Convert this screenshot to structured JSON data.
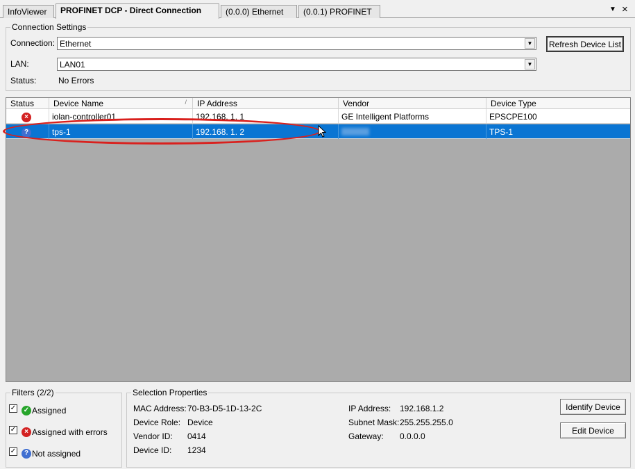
{
  "tabs": [
    {
      "label": "InfoViewer"
    },
    {
      "label": "PROFINET   DCP - Direct Connection"
    },
    {
      "label": "(0.0.0) Ethernet"
    },
    {
      "label": "(0.0.1) PROFINET"
    }
  ],
  "tab_controls": {
    "dropdown": "▼",
    "close": "×"
  },
  "connection_settings": {
    "title": "Connection Settings",
    "connection_label": "Connection:",
    "connection_value": "Ethernet",
    "lan_label": "LAN:",
    "lan_value": "LAN01",
    "status_label": "Status:",
    "status_value": "No Errors",
    "refresh_button": "Refresh Device List"
  },
  "grid": {
    "columns": [
      "Status",
      "Device Name",
      "IP Address",
      "Vendor",
      "Device Type"
    ],
    "sort_indicator": "/",
    "rows": [
      {
        "status_icon": "error-icon",
        "device_name": "iolan-controller01",
        "ip": "192.168.  1.  1",
        "vendor": "GE Intelligent Platforms",
        "type": "EPSCPE100"
      },
      {
        "status_icon": "question-icon",
        "device_name": "tps-1",
        "ip": "192.168.  1.  2",
        "vendor": "",
        "type": "TPS-1"
      }
    ]
  },
  "filters": {
    "title": "Filters  (2/2)",
    "items": [
      {
        "label": "Assigned",
        "checked": "✓"
      },
      {
        "label": "Assigned with errors",
        "checked": "✓"
      },
      {
        "label": "Not assigned",
        "checked": "✓"
      }
    ]
  },
  "selection": {
    "title": "Selection Properties",
    "mac_label": "MAC Address:",
    "mac_value": "70-B3-D5-1D-13-2C",
    "role_label": "Device Role:",
    "role_value": "Device",
    "vendor_id_label": "Vendor ID:",
    "vendor_id_value": "0414",
    "device_id_label": "Device ID:",
    "device_id_value": "1234",
    "ip_label": "IP Address:",
    "ip_value": "192.168.1.2",
    "subnet_label": "Subnet Mask:",
    "subnet_value": "255.255.255.0",
    "gateway_label": "Gateway:",
    "gateway_value": "0.0.0.0",
    "identify_button": "Identify Device",
    "edit_button": "Edit Device"
  },
  "colors": {
    "selection": "#0a75d3",
    "annotation": "#d9201d",
    "grid_bg": "#ababab"
  }
}
